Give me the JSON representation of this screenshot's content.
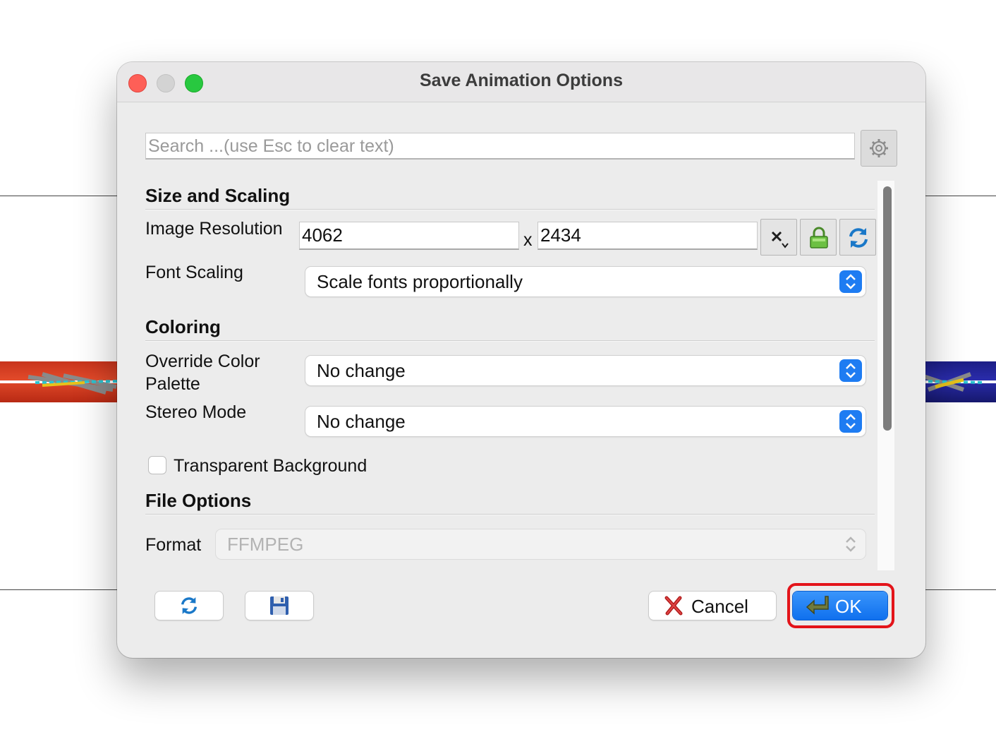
{
  "window": {
    "title": "Save Animation Options"
  },
  "search": {
    "placeholder": "Search ...(use Esc to clear text)"
  },
  "sections": {
    "size_scaling": "Size and Scaling",
    "coloring": "Coloring",
    "file_options": "File Options"
  },
  "fields": {
    "image_resolution_label": "Image Resolution",
    "width": "4062",
    "separator": "x",
    "height": "2434",
    "font_scaling_label": "Font Scaling",
    "font_scaling_value": "Scale fonts proportionally",
    "override_palette_label_line1": "Override Color",
    "override_palette_label_line2": "Palette",
    "override_palette_value": "No change",
    "stereo_mode_label": "Stereo Mode",
    "stereo_mode_value": "No change",
    "transparent_bg_label": "Transparent Background",
    "transparent_bg_checked": false,
    "format_label": "Format",
    "format_value": "FFMPEG"
  },
  "buttons": {
    "cancel": "Cancel",
    "ok": "OK"
  },
  "icons": {
    "settings": "gear-icon",
    "clear": "x-dropdown-icon",
    "lock": "lock-icon",
    "refresh": "refresh-icon",
    "reset": "refresh-icon",
    "save": "floppy-disk-icon",
    "cancel": "red-x-icon",
    "ok": "enter-arrow-icon"
  },
  "colors": {
    "accent": "#1e7cf2",
    "highlight": "#e3141a"
  }
}
